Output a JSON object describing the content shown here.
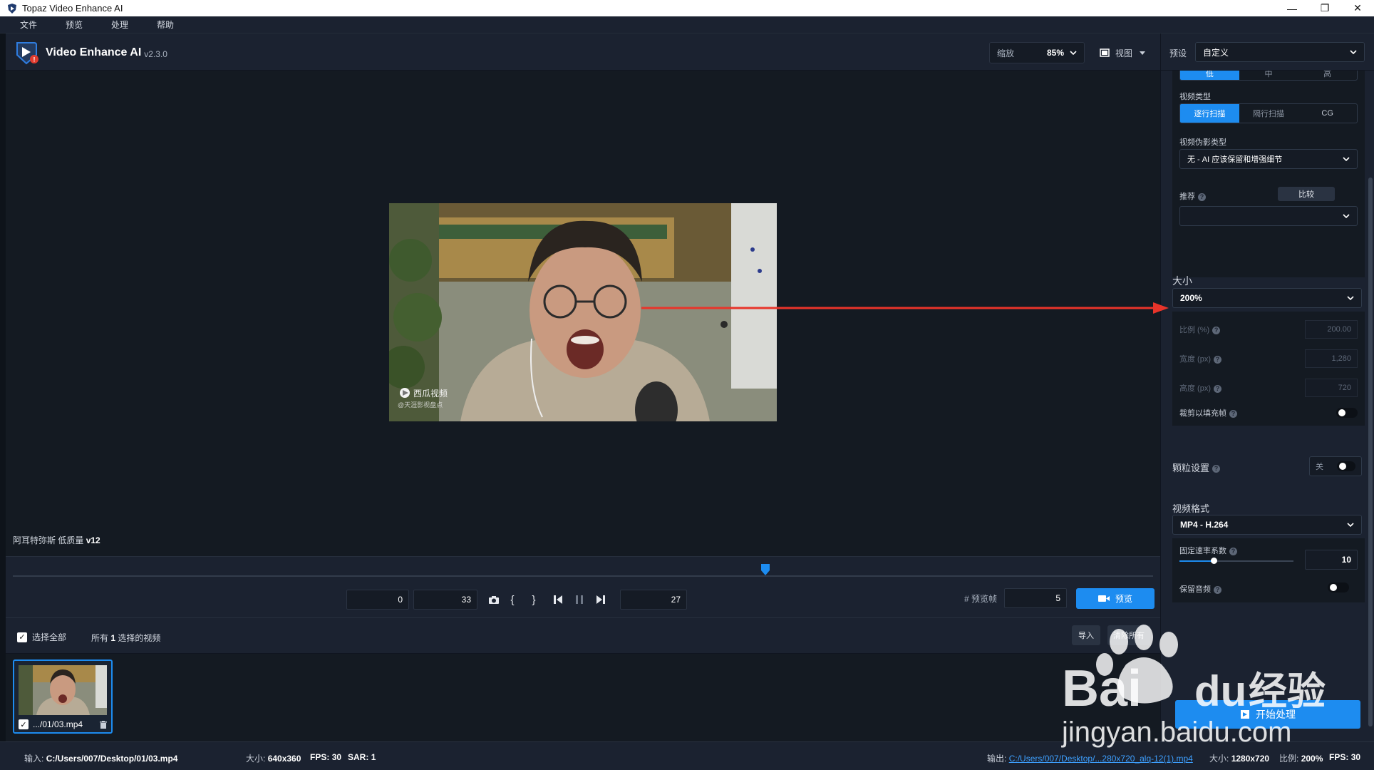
{
  "window": {
    "title": "Topaz Video Enhance AI"
  },
  "menu": [
    "文件",
    "预览",
    "处理",
    "帮助"
  ],
  "brand": {
    "name": "Video Enhance AI",
    "version": "v2.3.0"
  },
  "header": {
    "zoom_label": "缩放",
    "zoom_value": "85%",
    "view_label": "视图"
  },
  "preview": {
    "model_label": "阿耳特弥斯 低质量",
    "model_version": "v12",
    "video_watermark": "西瓜视频",
    "video_watermark_sub": "@天涯影视盘点"
  },
  "timeline": {
    "start_frame": "0",
    "end_frame": "33",
    "current_frame": "27",
    "preview_frames_label": "# 预览帧",
    "preview_frames_value": "5",
    "preview_button": "预览",
    "playhead_fraction": 0.66
  },
  "selection": {
    "select_all": "选择全部",
    "all_prefix": "所有",
    "count": "1",
    "all_suffix": "选择的视频",
    "import_button": "导入",
    "clear_button": "清除所有"
  },
  "files": [
    {
      "name": ".../01/03.mp4"
    }
  ],
  "status": {
    "input_label": "输入:",
    "input_path": "C:/Users/007/Desktop/01/03.mp4",
    "size_label": "大小:",
    "size_value": "640x360",
    "fps_label": "FPS:",
    "fps_value": "30",
    "sar_label": "SAR:",
    "sar_value": "1",
    "output_label": "输出:",
    "output_path": "C:/Users/007/Desktop/...280x720_alq-12(1).mp4",
    "out_size_label": "大小:",
    "out_size_value": "1280x720",
    "scale_label": "比例:",
    "scale_value": "200%",
    "out_fps_label": "FPS:",
    "out_fps_value": "30"
  },
  "right_panel": {
    "preset_label": "预设",
    "preset_value": "自定义",
    "quality_segments": [
      "低",
      "中",
      "高"
    ],
    "video_type_label": "视频类型",
    "video_type_segments": [
      "逐行扫描",
      "隔行扫描",
      "CG"
    ],
    "artifact_label": "视频伪影类型",
    "artifact_value": "无 - AI 应该保留和增强细节",
    "recommend_label": "推荐",
    "compare_button": "比较",
    "recommend_value": "",
    "size_title": "大小",
    "size_value": "200%",
    "scale_label": "比例 (%)",
    "scale_value": "200.00",
    "width_label": "宽度 (px)",
    "width_value": "1,280",
    "height_label": "高度 (px)",
    "height_value": "720",
    "crop_label": "裁剪以填充帧",
    "grain_title": "颗粒设置",
    "grain_toggle_label": "关",
    "format_title": "视频格式",
    "format_value": "MP4 - H.264",
    "crf_label": "固定速率系数",
    "crf_value": "10",
    "crf_fraction": 0.3,
    "keep_audio_label": "保留音频",
    "start_button": "开始处理"
  },
  "watermark": {
    "brand_a": "Bai",
    "brand_b": "du",
    "brand_cn": "经验",
    "url": "jingyan.baidu.com"
  },
  "colors": {
    "accent": "#1d8cf0",
    "background": "#141a22",
    "panel": "#1b2230",
    "arrow": "#e8342a"
  }
}
